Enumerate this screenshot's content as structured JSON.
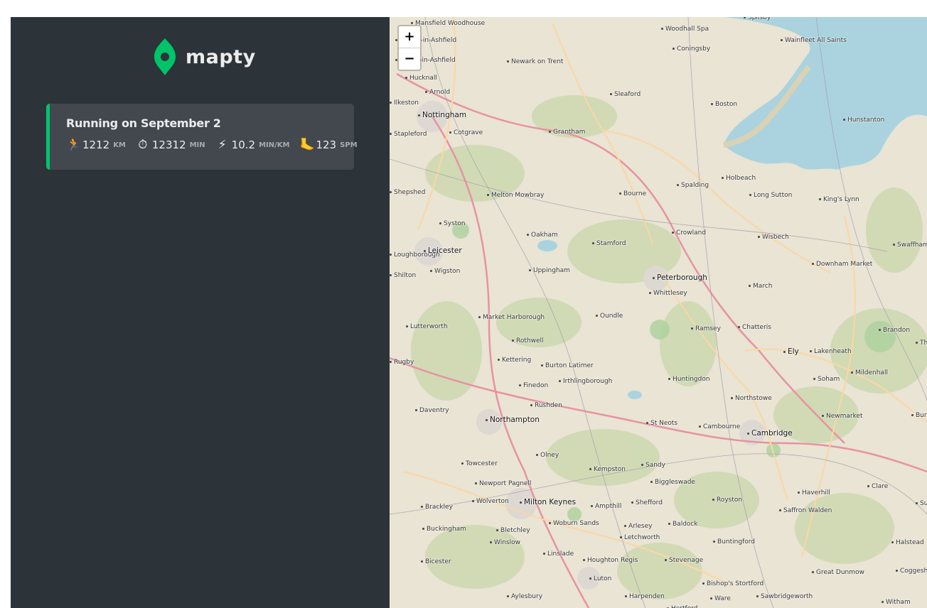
{
  "app": {
    "logo_text": "mapty"
  },
  "workouts": [
    {
      "title": "Running on September 2",
      "type": "running",
      "color": "#00c46a",
      "details": [
        {
          "icon": "runner-icon",
          "glyph": "🏃",
          "value": "1212",
          "unit": "km"
        },
        {
          "icon": "stopwatch-icon",
          "glyph": "⏱",
          "value": "12312",
          "unit": "min"
        },
        {
          "icon": "lightning-icon",
          "glyph": "⚡",
          "value": "10.2",
          "unit": "min/km"
        },
        {
          "icon": "foot-icon",
          "glyph": "🦶",
          "value": "123",
          "unit": "spm"
        }
      ]
    }
  ],
  "map": {
    "zoom_in_label": "+",
    "zoom_out_label": "−",
    "places": [
      "Mansfield Woodhouse",
      "Woodhall Spa",
      "Coningsby",
      "Wainfleet All Saints",
      "Sutton-in-Ashfield",
      "Kirkby-in-Ashfield",
      "Newark on Trent",
      "Hucknall",
      "Arnold",
      "Sleaford",
      "Boston",
      "Ilkeston",
      "Nottingham",
      "Stapleford",
      "Cotgrave",
      "Grantham",
      "Hunstanton",
      "Holbeach",
      "Spalding",
      "Long Sutton",
      "Shepshed",
      "Melton Mowbray",
      "Bourne",
      "King's Lynn",
      "Syston",
      "Oakham",
      "Crowland",
      "Wisbech",
      "Stamford",
      "Loughborough",
      "Leicester",
      "Swaffham",
      "Shilton",
      "Wigston",
      "Uppingham",
      "Peterborough",
      "Downham Market",
      "Whittlesey",
      "March",
      "Market Harborough",
      "Oundle",
      "Lutterworth",
      "Ramsey",
      "Chatteris",
      "Brandon",
      "Thetford",
      "Rothwell",
      "Ely",
      "Lakenheath",
      "Rugby",
      "Kettering",
      "Burton Latimer",
      "Irthlingborough",
      "Huntingdon",
      "Soham",
      "Mildenhall",
      "Finedon",
      "Rushden",
      "Northstowe",
      "Daventry",
      "Northampton",
      "Newmarket",
      "Bury St Edmunds",
      "St Neots",
      "Cambourne",
      "Cambridge",
      "Olney",
      "Towcester",
      "Kempston",
      "Sandy",
      "Biggleswade",
      "Newport Pagnell",
      "Haverhill",
      "Clare",
      "Wolverton",
      "Milton Keynes",
      "Ampthill",
      "Shefford",
      "Royston",
      "Saffron Walden",
      "Sudbury",
      "Brackley",
      "Woburn Sands",
      "Arlesey",
      "Baldock",
      "Buckingham",
      "Bletchley",
      "Letchworth",
      "Buntingford",
      "Winslow",
      "Halstead",
      "Linslade",
      "Houghton Regis",
      "Stevenage",
      "Bicester",
      "Great Dunmow",
      "Coggeshall",
      "Luton",
      "Bishop's Stortford",
      "Aylesbury",
      "Harpenden",
      "Ware",
      "Sawbridgeworth",
      "Witham",
      "Hertford",
      "Spilsby"
    ]
  }
}
